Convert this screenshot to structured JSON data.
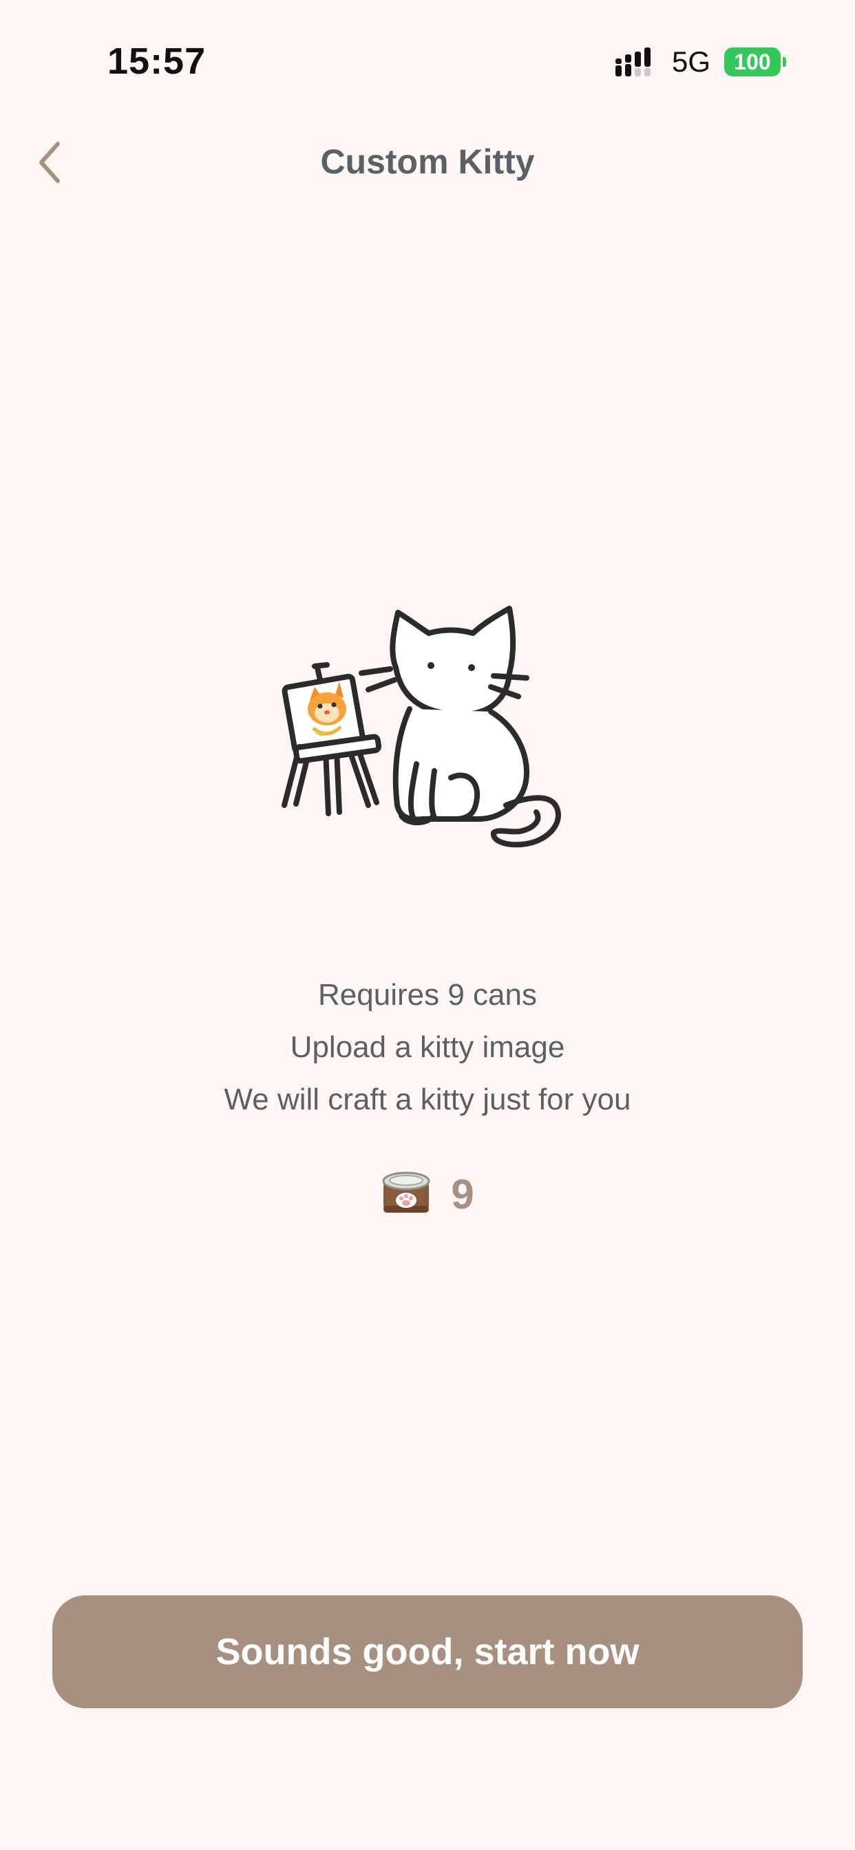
{
  "status_bar": {
    "time": "15:57",
    "network": "5G",
    "battery": "100",
    "battery_color": "#34c759"
  },
  "nav": {
    "back_icon": "chevron-left-icon",
    "title": "Custom Kitty"
  },
  "illustration": {
    "icon": "cat-painting-illustration"
  },
  "description": {
    "lines": [
      "Requires 9 cans",
      "Upload a kitty image",
      "We will craft a kitty just for you"
    ]
  },
  "cost": {
    "icon": "cat-food-can-icon",
    "value": "9"
  },
  "cta": {
    "label": "Sounds good, start now"
  },
  "colors": {
    "background": "#fdf6f4",
    "accent": "#a89080",
    "text": "#5b5f66"
  }
}
